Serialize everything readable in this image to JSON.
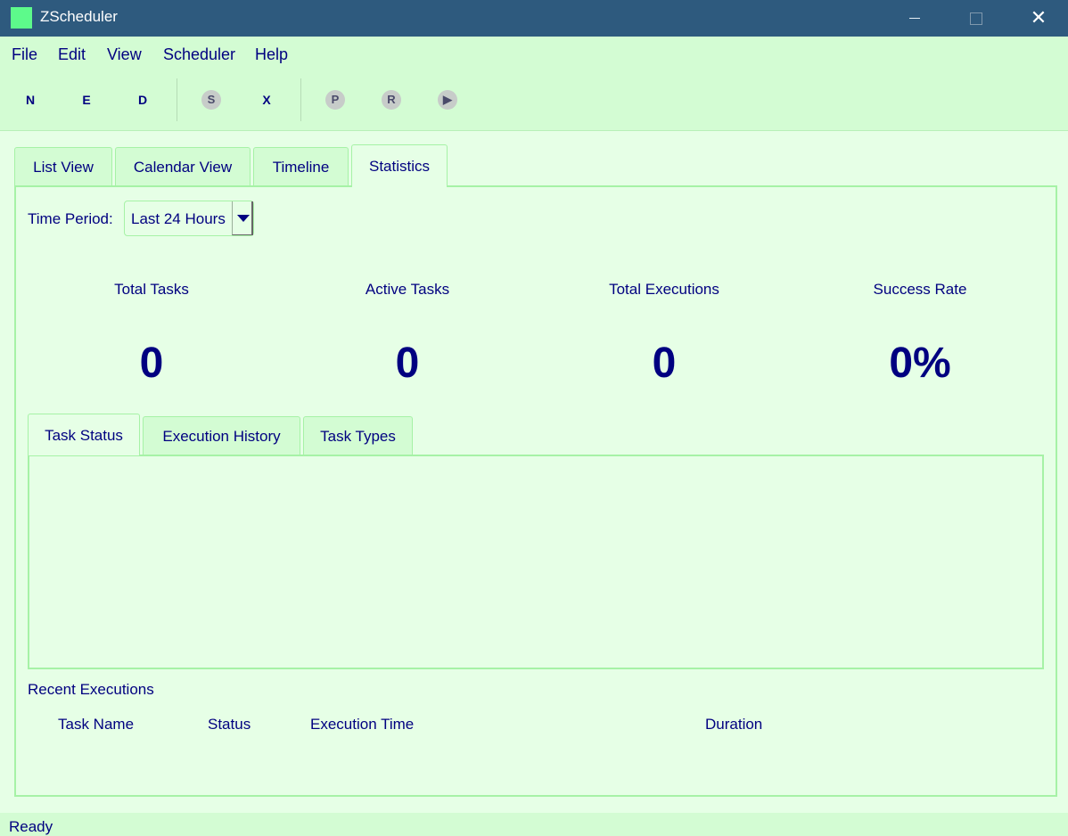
{
  "window": {
    "title": "ZScheduler"
  },
  "menu": {
    "items": [
      "File",
      "Edit",
      "View",
      "Scheduler",
      "Help"
    ]
  },
  "toolbar": {
    "buttons": [
      {
        "label": "N",
        "icon": "new-task-icon"
      },
      {
        "label": "E",
        "icon": "edit-task-icon"
      },
      {
        "label": "D",
        "icon": "delete-task-icon"
      },
      {
        "label": "S",
        "icon": "start-scheduler-icon"
      },
      {
        "label": "X",
        "icon": "stop-scheduler-icon"
      },
      {
        "label": "P",
        "icon": "pause-icon"
      },
      {
        "label": "R",
        "icon": "resume-icon"
      },
      {
        "label": "▶",
        "icon": "run-icon"
      }
    ]
  },
  "main_tabs": [
    "List View",
    "Calendar View",
    "Timeline",
    "Statistics"
  ],
  "active_main_tab": "Statistics",
  "filter": {
    "label": "Time Period:",
    "value": "Last 24 Hours"
  },
  "stats": [
    {
      "label": "Total Tasks",
      "value": "0"
    },
    {
      "label": "Active Tasks",
      "value": "0"
    },
    {
      "label": "Total Executions",
      "value": "0"
    },
    {
      "label": "Success Rate",
      "value": "0%"
    }
  ],
  "chart_tabs": [
    "Task Status",
    "Execution History",
    "Task Types"
  ],
  "active_chart_tab": "Task Status",
  "recent": {
    "title": "Recent Executions",
    "columns": [
      "Task Name",
      "Status",
      "Execution Time",
      "Duration"
    ]
  },
  "status_bar": {
    "text": "Ready"
  },
  "colors": {
    "title_bar": "#2e5a7e",
    "background": "#d3fcd3",
    "content": "#e6ffe6",
    "text": "#000080",
    "border": "#a6f2a6"
  }
}
